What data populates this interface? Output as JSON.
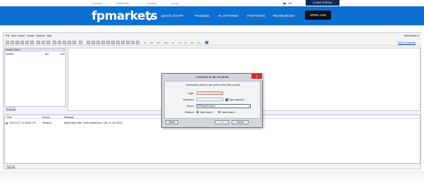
{
  "topbar": {
    "links": [
      "Contact",
      "Webtrader",
      "Funding",
      "Group"
    ],
    "language": "UK",
    "client_portal": "CLIENT PORTAL"
  },
  "nav": {
    "logo": "fpmarkets",
    "items": [
      "QUICK START",
      "TRADING",
      "PLATFORMS",
      "PARTNERS",
      "RESOURCES"
    ],
    "open_live": "OPEN LIVE"
  },
  "terminal": {
    "menu": [
      "File",
      "View",
      "Insert",
      "Charts",
      "Options",
      "Help"
    ],
    "brand_label": "MetaTrader 4",
    "toolbar_text": [
      "M1",
      "M5",
      "M15",
      "M30",
      "H1",
      "H4",
      "D1",
      "W1",
      "MN"
    ],
    "mql_link": "MQL5 community",
    "market_watch": {
      "title": "Market Watch",
      "columns": [
        "Symbol",
        "Bid",
        "Ask"
      ],
      "tab": "Symbols"
    },
    "log": {
      "columns": [
        "Time",
        "Source",
        "Message"
      ],
      "rows": [
        {
          "time": "2022.01.27 18:06:56.276",
          "source": "Terminal",
          "message": "MetaTrader Web Trader started (rev. 236, 03 Jun 2021)"
        }
      ],
      "tab": "Journal"
    }
  },
  "dialog": {
    "title": "Connect to an Account",
    "close": "x",
    "message": "Authorization allows to get access to the trade account",
    "login_label": "Login:",
    "password_label": "Password:",
    "save_password": "Save password",
    "server_label": "Server:",
    "server_value": "FPMarkets-Demo",
    "platform_label": "Platform:",
    "platform_mt4": "MetaTrader 4",
    "platform_mt5": "MetaTrader 5",
    "demo_btn": "Demo",
    "ok_btn": "OK",
    "cancel_btn": "Cancel"
  },
  "colors": {
    "nav_blue": "#0d6fd0",
    "portal_navy": "#0f2c57",
    "close_red": "#d62b2b"
  }
}
